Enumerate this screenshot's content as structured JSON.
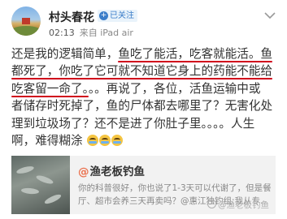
{
  "post": {
    "author": "村头春花",
    "badge_icon": "plus-icon",
    "badge_label": "已关注",
    "time": "02:13",
    "source": "来自 iPad air",
    "text_lines": [
      [
        "还是我的逻辑简单，",
        "鱼吃了能活，吃客就能活。鱼"
      ],
      [
        "都死了，你吃了它可就不知道它身上的药能不能给"
      ],
      [
        "吃客留一命了。",
        "。。再说了，各位，活鱼运输中或"
      ],
      [
        "者储存时死掉了，鱼的尸体都去哪里了？无害化处"
      ],
      [
        "理到垃圾场了？还不是进了你肚子里。。。。人生"
      ],
      [
        "啊，难得糊涂"
      ]
    ],
    "emoji_icon": "laugh-cry-emoji"
  },
  "card": {
    "title": "渔老板钓鱼",
    "desc_line1": "你的科普很好，你也说了1-3天可以代谢了，但是餐",
    "desc_line2": "厅、超市会养三天再卖吗？@惠江独钓组:我从专..."
  },
  "watermark": "@渔老板钓鱼",
  "colors": {
    "underline": "#d0021b",
    "mention": "#eb7350",
    "badge": "#3a7dc9"
  }
}
